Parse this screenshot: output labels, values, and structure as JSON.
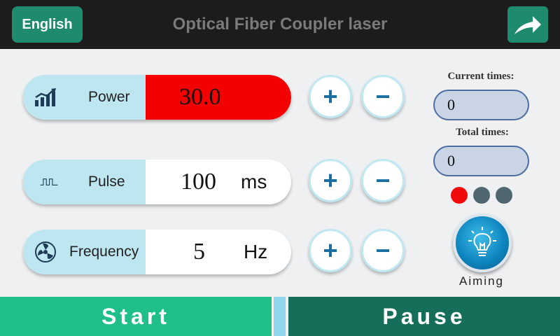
{
  "header": {
    "language_label": "English",
    "title": "Optical Fiber Coupler laser",
    "exit_icon": "arrow-exit-icon"
  },
  "params": {
    "power": {
      "label": "Power",
      "value": "30.0",
      "unit": "",
      "icon": "chart-trend-icon",
      "value_bg": "#f40000"
    },
    "pulse": {
      "label": "Pulse",
      "value": "100",
      "unit": "ms",
      "icon": "pulse-wave-icon"
    },
    "frequency": {
      "label": "Frequency",
      "value": "5",
      "unit": "Hz",
      "icon": "fan-icon"
    }
  },
  "controls": {
    "plus": "+",
    "minus": "−"
  },
  "counters": {
    "current_label": "Current times:",
    "current_value": "0",
    "total_label": "Total times:",
    "total_value": "0"
  },
  "indicators": [
    {
      "state": "active",
      "color": "#f00a0a"
    },
    {
      "state": "inactive",
      "color": "#4f6570"
    },
    {
      "state": "inactive",
      "color": "#4f6570"
    }
  ],
  "aiming": {
    "label": "Aiming",
    "icon": "light-bulb-icon"
  },
  "actions": {
    "start": "Start",
    "pause": "Pause"
  },
  "colors": {
    "accent": "#1e8a6e",
    "start": "#1fbf8a",
    "pause": "#146e59",
    "label_bg": "#bde6f0"
  }
}
